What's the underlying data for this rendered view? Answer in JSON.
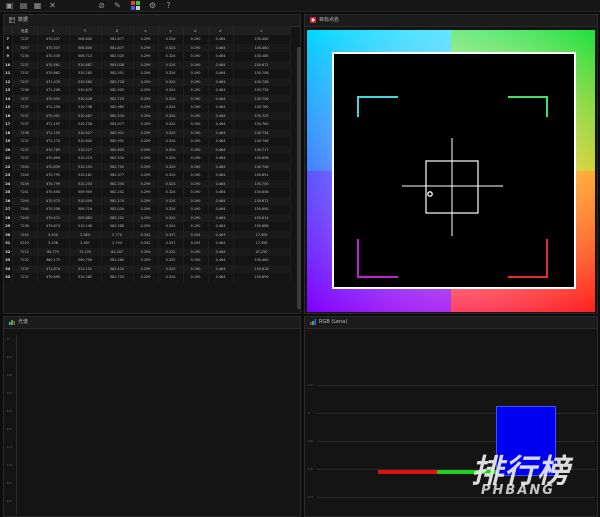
{
  "toolbar": {
    "icons": [
      "new-file-icon",
      "open-folder-icon",
      "save-icon",
      "close-icon",
      "link-icon",
      "edit-icon",
      "palette-icon",
      "settings-icon",
      "help-icon"
    ]
  },
  "data_panel": {
    "title": "数据",
    "columns": [
      "色温",
      "X",
      "Y",
      "Z",
      "x",
      "y",
      "u'",
      "v'",
      "L"
    ],
    "rows": [
      [
        "7",
        "7237",
        "470.537",
        "506.800",
        "581.877",
        "0.299",
        "0.324",
        "0.190",
        "0.464",
        "150.460"
      ],
      [
        "8",
        "7257",
        "470.537",
        "506.800",
        "581.877",
        "0.299",
        "0.324",
        "0.190",
        "0.464",
        "150.460"
      ],
      [
        "9",
        "7235",
        "470.539",
        "506.713",
        "582.025",
        "0.299",
        "0.324",
        "0.190",
        "0.464",
        "150.385"
      ],
      [
        "10",
        "7237",
        "470.561",
        "510.887",
        "583.038",
        "0.299",
        "0.324",
        "0.190",
        "0.464",
        "150.672"
      ],
      [
        "11",
        "7237",
        "470.882",
        "510.283",
        "582.551",
        "0.299",
        "0.324",
        "0.190",
        "0.464",
        "150.708"
      ],
      [
        "12",
        "7237",
        "471.070",
        "510.560",
        "582.728",
        "0.299",
        "0.324",
        "0.190",
        "0.464",
        "150.708"
      ],
      [
        "13",
        "7236",
        "471.206",
        "510.675",
        "582.903",
        "0.299",
        "0.324",
        "0.190",
        "0.464",
        "150.735"
      ],
      [
        "14",
        "7237",
        "470.950",
        "510.428",
        "582.729",
        "0.299",
        "0.324",
        "0.190",
        "0.464",
        "150.706"
      ],
      [
        "15",
        "7237",
        "471.259",
        "510.736",
        "582.965",
        "0.299",
        "0.324",
        "0.190",
        "0.464",
        "150.760"
      ],
      [
        "16",
        "7237",
        "470.901",
        "510.467",
        "582.534",
        "0.299",
        "0.324",
        "0.190",
        "0.464",
        "150.725"
      ],
      [
        "17",
        "7237",
        "471.197",
        "510.758",
        "583.077",
        "0.299",
        "0.324",
        "0.190",
        "0.464",
        "150.760"
      ],
      [
        "18",
        "7236",
        "471.155",
        "510.627",
        "582.921",
        "0.299",
        "0.324",
        "0.190",
        "0.464",
        "150.734"
      ],
      [
        "19",
        "7237",
        "471.173",
        "510.600",
        "582.901",
        "0.299",
        "0.324",
        "0.190",
        "0.464",
        "150.746"
      ],
      [
        "20",
        "7237",
        "470.769",
        "510.227",
        "582.603",
        "0.299",
        "0.324",
        "0.190",
        "0.464",
        "150.717"
      ],
      [
        "21",
        "7237",
        "470.894",
        "510.213",
        "582.534",
        "0.299",
        "0.324",
        "0.190",
        "0.464",
        "150.696"
      ],
      [
        "22",
        "7240",
        "470.839",
        "510.253",
        "582.705",
        "0.299",
        "0.324",
        "0.190",
        "0.464",
        "150.706"
      ],
      [
        "23",
        "7240",
        "470.795",
        "510.181",
        "582.377",
        "0.299",
        "0.324",
        "0.190",
        "0.464",
        "150.691"
      ],
      [
        "24",
        "7239",
        "470.799",
        "510.253",
        "582.350",
        "0.299",
        "0.324",
        "0.190",
        "0.464",
        "150.700"
      ],
      [
        "25",
        "7241",
        "470.404",
        "509.909",
        "582.202",
        "0.299",
        "0.324",
        "0.190",
        "0.464",
        "150.658"
      ],
      [
        "26",
        "7240",
        "470.575",
        "510.009",
        "582.274",
        "0.299",
        "0.324",
        "0.190",
        "0.464",
        "150.672"
      ],
      [
        "27",
        "7240",
        "470.556",
        "509.719",
        "582.034",
        "0.299",
        "0.324",
        "0.190",
        "0.464",
        "150.690"
      ],
      [
        "28",
        "7240",
        "470.471",
        "509.883",
        "582.202",
        "0.299",
        "0.324",
        "0.190",
        "0.464",
        "150.614"
      ],
      [
        "29",
        "7238",
        "470.673",
        "510.146",
        "582.588",
        "0.299",
        "0.324",
        "0.190",
        "0.464",
        "150.686"
      ],
      [
        "30",
        "7245",
        "3.530",
        "2.364",
        "2.770",
        "0.342",
        "0.337",
        "0.204",
        "0.463",
        "17.309"
      ],
      [
        "31",
        "5220",
        "3.236",
        "3.387",
        "2.794",
        "0.342",
        "0.337",
        "0.193",
        "0.464",
        "17.306"
      ],
      [
        "32",
        "7212",
        "60.770",
        "72.109",
        "81.247",
        "0.299",
        "0.325",
        "0.190",
        "0.464",
        "47.250"
      ],
      [
        "33",
        "7232",
        "460.175",
        "590.756",
        "581.560",
        "0.299",
        "0.325",
        "0.190",
        "0.464",
        "150.460"
      ],
      [
        "34",
        "7237",
        "471.874",
        "511.151",
        "583.420",
        "0.299",
        "0.324",
        "0.190",
        "0.464",
        "150.818"
      ],
      [
        "35",
        "7237",
        "470.895",
        "510.285",
        "582.703",
        "0.299",
        "0.324",
        "0.190",
        "0.464",
        "150.699"
      ]
    ]
  },
  "target_panel": {
    "title": "目标点名"
  },
  "bottom_left_panel": {
    "title": "光谱",
    "y_ticks": [
      "1",
      "0.9",
      "0.8",
      "0.7",
      "0.6",
      "0.5",
      "0.4",
      "0.3",
      "0.2",
      "0.1"
    ]
  },
  "rgb_panel": {
    "title": "RGB (Lena)",
    "y_ticks": [
      "1.2",
      "1",
      "0.8",
      "0.6",
      "0.4",
      "0.2"
    ],
    "colors": {
      "red": "#e01010",
      "green": "#20d020",
      "blue": "#0000f0"
    }
  },
  "watermark": {
    "main": "排行榜",
    "sub": "PHBANG"
  }
}
